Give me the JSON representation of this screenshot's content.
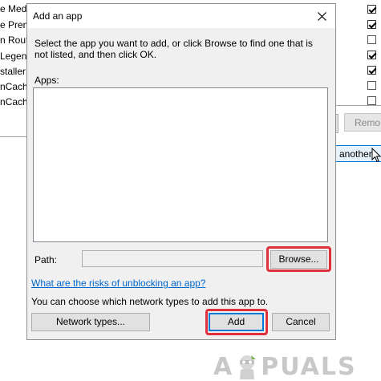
{
  "background": {
    "list_items": [
      "e Medi",
      "e Prem",
      "n Rout",
      "Legend",
      "staller",
      "nCach",
      "nCach"
    ],
    "checkboxes": [
      true,
      true,
      false,
      true,
      true,
      false,
      false
    ],
    "remove_label": "Remo",
    "another_label": "another"
  },
  "dialog": {
    "title": "Add an app",
    "description": "Select the app you want to add, or click Browse to find one that is not listed, and then click OK.",
    "apps_label": "Apps:",
    "path_label": "Path:",
    "path_value": "",
    "browse_label": "Browse...",
    "risk_link": "What are the risks of unblocking an app?",
    "network_text": "You can choose which network types to add this app to.",
    "network_types_label": "Network types...",
    "add_label": "Add",
    "cancel_label": "Cancel"
  },
  "watermark": {
    "prefix": "A",
    "suffix": "PUALS"
  },
  "colors": {
    "highlight": "#e0303b",
    "link": "#0066cc",
    "dialog_bg": "#f0f0f0"
  }
}
